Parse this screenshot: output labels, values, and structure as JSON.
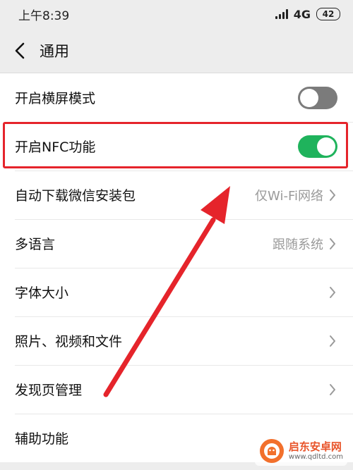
{
  "status_bar": {
    "time": "上午8:39",
    "network": "4G",
    "battery": "42"
  },
  "nav": {
    "title": "通用"
  },
  "settings": [
    {
      "label": "开启横屏模式",
      "type": "toggle",
      "state": "off"
    },
    {
      "label": "开启NFC功能",
      "type": "toggle",
      "state": "on"
    },
    {
      "label": "自动下载微信安装包",
      "type": "link",
      "value": "仅Wi-Fi网络"
    },
    {
      "label": "多语言",
      "type": "link",
      "value": "跟随系统"
    },
    {
      "label": "字体大小",
      "type": "link",
      "value": ""
    },
    {
      "label": "照片、视频和文件",
      "type": "link",
      "value": ""
    },
    {
      "label": "发现页管理",
      "type": "link",
      "value": ""
    },
    {
      "label": "辅助功能",
      "type": "link",
      "value": ""
    }
  ],
  "watermark": {
    "name": "启东安卓网",
    "url": "www.qdltd.com"
  },
  "colors": {
    "toggle_on": "#1fb35c",
    "toggle_off": "#7b7b7b",
    "highlight": "#e5242b",
    "secondary_text": "#9a9a9a"
  }
}
